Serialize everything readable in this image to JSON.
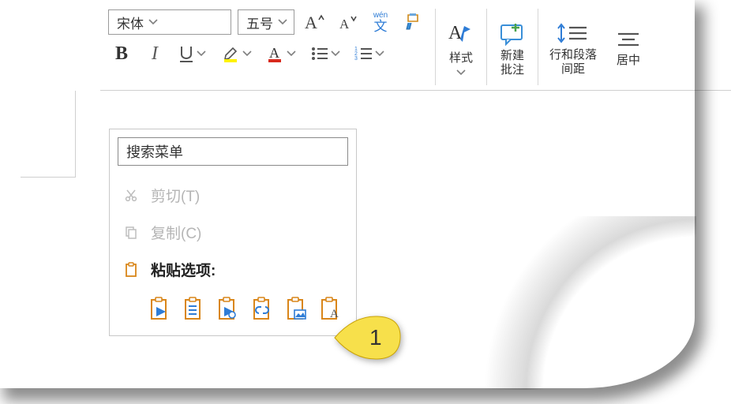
{
  "ribbon": {
    "font_name": "宋体",
    "font_size": "五号",
    "phonetic_top": "wén",
    "phonetic_bottom": "文",
    "styles_label": "样式",
    "new_comment_label": "新建\n批注",
    "spacing_label": "行和段落\n间距",
    "align_label": "居中"
  },
  "menu": {
    "search_placeholder": "搜索菜单",
    "cut_label": "剪切(T)",
    "copy_label": "复制(C)",
    "paste_header": "粘贴选项:"
  },
  "callout": {
    "number": "1"
  }
}
